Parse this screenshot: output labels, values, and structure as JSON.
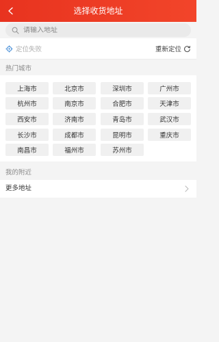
{
  "header": {
    "title": "选择收货地址",
    "back_icon": "chevron-left-icon",
    "color": "#ec3a24"
  },
  "search": {
    "placeholder": "请输入地址",
    "value": "",
    "icon": "search-icon"
  },
  "location": {
    "status": "定位失败",
    "status_icon": "crosshair-icon",
    "relocate_label": "重新定位",
    "relocate_icon": "refresh-icon"
  },
  "hot_cities": {
    "title": "热门城市",
    "cities": [
      "上海市",
      "北京市",
      "深圳市",
      "广州市",
      "杭州市",
      "南京市",
      "合肥市",
      "天津市",
      "西安市",
      "济南市",
      "青岛市",
      "武汉市",
      "长沙市",
      "成都市",
      "昆明市",
      "重庆市",
      "南昌市",
      "福州市",
      "苏州市"
    ]
  },
  "nearby": {
    "title": "我的附近",
    "more_label": "更多地址",
    "more_icon": "chevron-right-icon"
  }
}
